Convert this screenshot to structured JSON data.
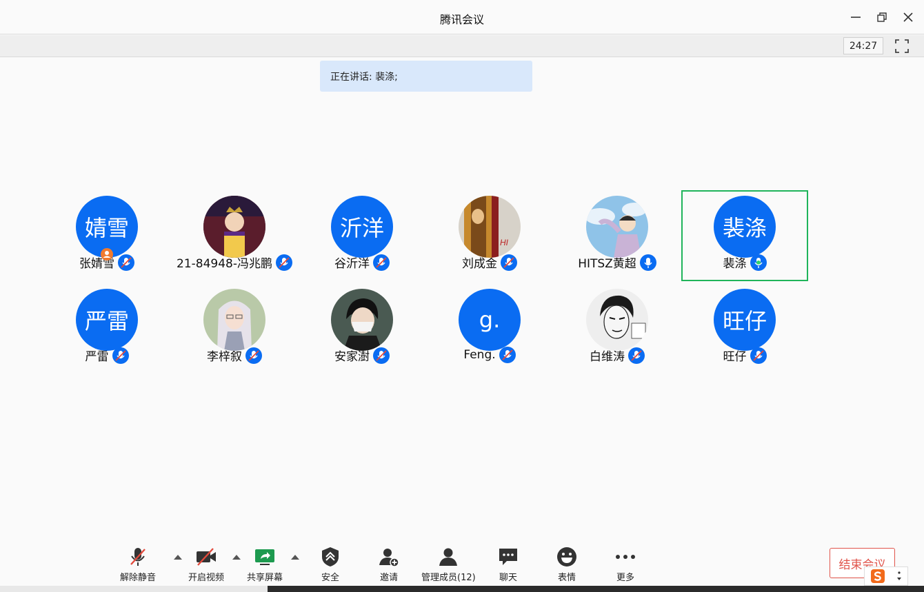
{
  "window": {
    "title": "腾讯会议"
  },
  "header": {
    "timer": "24:27"
  },
  "speaking_banner": "正在讲话: 裴涤;",
  "participants": [
    {
      "name": "张婧雪",
      "avatar_text": "婧雪",
      "avatar": "text",
      "host": true,
      "mic": "muted"
    },
    {
      "name": "21-84948-冯兆鹏",
      "avatar_text": "",
      "avatar": "photo-boy-crown",
      "mic": "muted"
    },
    {
      "name": "谷沂洋",
      "avatar_text": "沂洋",
      "avatar": "text",
      "mic": "muted"
    },
    {
      "name": "刘成金",
      "avatar_text": "",
      "avatar": "photo-dog",
      "mic": "muted"
    },
    {
      "name": "HITSZ黄超",
      "avatar_text": "",
      "avatar": "photo-anime-sky",
      "mic": "on"
    },
    {
      "name": "裴涤",
      "avatar_text": "裴涤",
      "avatar": "text",
      "mic": "speaking",
      "active": true
    },
    {
      "name": "严雷",
      "avatar_text": "严雷",
      "avatar": "text",
      "mic": "muted"
    },
    {
      "name": "李梓叙",
      "avatar_text": "",
      "avatar": "photo-anime-white-hair",
      "mic": "muted"
    },
    {
      "name": "安家澍",
      "avatar_text": "",
      "avatar": "photo-mask-boy",
      "mic": "muted"
    },
    {
      "name": "Feng.",
      "avatar_text": "g.",
      "avatar": "text",
      "mic": "muted"
    },
    {
      "name": "白维涛",
      "avatar_text": "",
      "avatar": "photo-manga",
      "mic": "muted"
    },
    {
      "name": "旺仔",
      "avatar_text": "旺仔",
      "avatar": "text",
      "mic": "muted"
    }
  ],
  "toolbar": {
    "unmute": "解除静音",
    "video": "开启视频",
    "share": "共享屏幕",
    "security": "安全",
    "invite": "邀请",
    "members": "管理成员(12)",
    "chat": "聊天",
    "emoji": "表情",
    "more": "更多",
    "end": "结束会议"
  },
  "colors": {
    "accent": "#0a6cf2",
    "speaking_border": "#1fb45a",
    "end": "#e0534a",
    "banner": "#d9e8fb"
  }
}
